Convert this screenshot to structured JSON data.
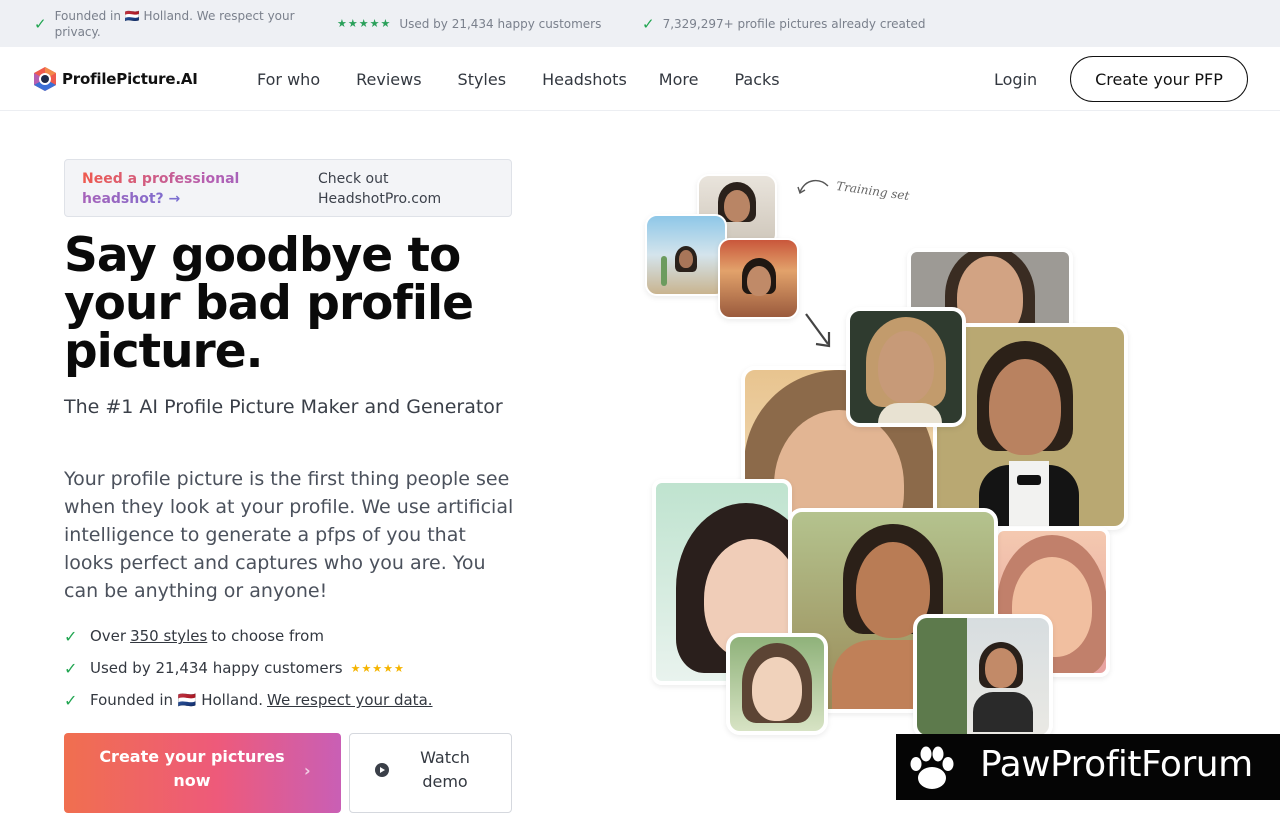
{
  "topbar": {
    "items": [
      {
        "text": "Founded in 🇳🇱 Holland. We respect your privacy."
      },
      {
        "stars": "★★★★★",
        "text": "Used by 21,434 happy customers"
      },
      {
        "text": "7,329,297+ profile pictures already created"
      }
    ]
  },
  "nav": {
    "logo_text": "ProfilePicture.AI",
    "links": [
      "For who",
      "Reviews",
      "Styles",
      "Headshots",
      "More",
      "Packs"
    ],
    "login": "Login",
    "cta": "Create your PFP"
  },
  "promo": {
    "left": "Need a professional headshot? →",
    "right": "Check out HeadshotPro.com"
  },
  "hero": {
    "title": "Say goodbye to your bad profile picture.",
    "subtitle": "The #1 AI Profile Picture Maker and Generator",
    "description": "Your profile picture is the first thing people see when they look at your profile. We use artificial intelligence to generate a pfps of you that looks perfect and captures who you are. You can be anything or anyone!",
    "bullets": [
      {
        "pre": "Over",
        "link": "350 styles",
        "post": "to choose from"
      },
      {
        "pre": "Used by 21,434 happy customers",
        "stars": "★★★★★"
      },
      {
        "pre": "Founded in 🇳🇱 Holland.",
        "link": "We respect your data."
      }
    ],
    "cta_main": "Create your pictures now",
    "cta_arrow": "›",
    "cta_demo": "Watch demo"
  },
  "collage": {
    "training_label": "Training set"
  },
  "watermark": {
    "text": "PawProfitForum"
  },
  "colors": {
    "check": "#22a652",
    "brand_gradient": [
      "#f06f4f",
      "#ee5a7a",
      "#c95fb5"
    ],
    "star": "#f5b400"
  }
}
